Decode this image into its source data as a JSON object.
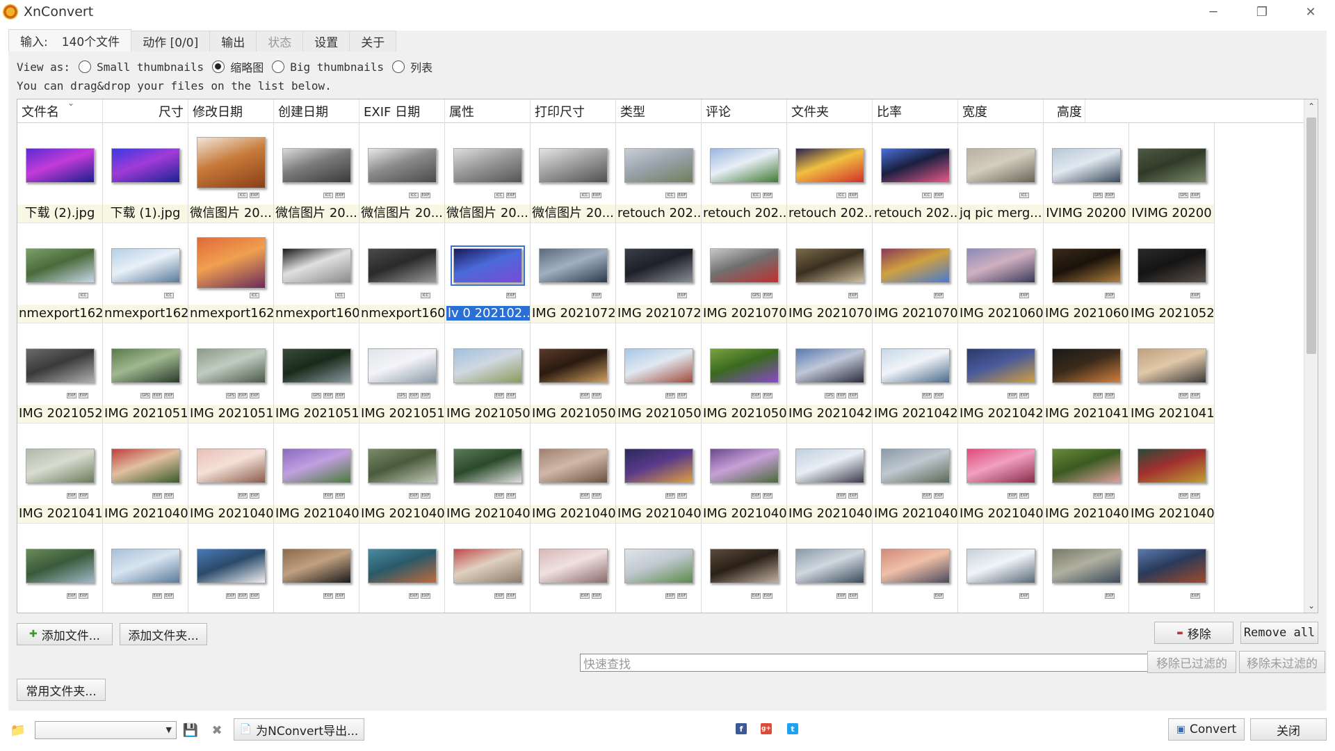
{
  "window": {
    "title": "XnConvert",
    "minimize": "─",
    "restore": "❐",
    "close": "✕"
  },
  "tabs": [
    {
      "label": "输入:",
      "count": "140个文件",
      "active": true,
      "disabled": false
    },
    {
      "label": "动作 [0/0]",
      "active": false,
      "disabled": false
    },
    {
      "label": "输出",
      "active": false,
      "disabled": false
    },
    {
      "label": "状态",
      "active": false,
      "disabled": true
    },
    {
      "label": "设置",
      "active": false,
      "disabled": false
    },
    {
      "label": "关于",
      "active": false,
      "disabled": false
    }
  ],
  "view_as": {
    "label": "View as:",
    "options": [
      {
        "label": "Small thumbnails",
        "checked": false
      },
      {
        "label": "缩略图",
        "checked": true
      },
      {
        "label": "Big thumbnails",
        "checked": false
      },
      {
        "label": "列表",
        "checked": false
      }
    ]
  },
  "hint": "You can drag&drop your files on the list below.",
  "columns": [
    "文件名",
    "尺寸",
    "修改日期",
    "创建日期",
    "EXIF 日期",
    "属性",
    "打印尺寸",
    "类型",
    "评论",
    "文件夹",
    "比率",
    "宽度",
    "高度"
  ],
  "files": [
    {
      "name": "下载 (2).jpg",
      "colors": [
        "#5a2bd1",
        "#1b1f8a",
        "#c33bd9"
      ],
      "badges": []
    },
    {
      "name": "下载 (1).jpg",
      "colors": [
        "#3a3ae0",
        "#1c2390",
        "#a13bd8"
      ],
      "badges": []
    },
    {
      "name": "微信图片 20...",
      "colors": [
        "#f0e6d8",
        "#8a3e16",
        "#c77a3a"
      ],
      "badges": [
        "ICC",
        "EXIF"
      ],
      "tall": true
    },
    {
      "name": "微信图片 20...",
      "colors": [
        "#d9d9d9",
        "#3a3a3a",
        "#7a7a7a"
      ],
      "badges": [
        "ICC",
        "EXIF"
      ]
    },
    {
      "name": "微信图片 20...",
      "colors": [
        "#e8e8e8",
        "#4a4a4a",
        "#8a8a8a"
      ],
      "badges": [
        "ICC",
        "EXIF"
      ]
    },
    {
      "name": "微信图片 20...",
      "colors": [
        "#dedede",
        "#555555",
        "#9a9a9a"
      ],
      "badges": [
        "ICC",
        "EXIF"
      ]
    },
    {
      "name": "微信图片 20...",
      "colors": [
        "#e4e4e4",
        "#505050",
        "#a0a0a0"
      ],
      "badges": [
        "ICC",
        "EXIF"
      ]
    },
    {
      "name": "retouch 202...",
      "colors": [
        "#c9ced6",
        "#6e7f5a",
        "#9aa3ad"
      ],
      "badges": [
        "ICC",
        "EXIF"
      ]
    },
    {
      "name": "retouch 202...",
      "colors": [
        "#9ab6e0",
        "#3f7a34",
        "#e8eef5"
      ],
      "badges": [
        "ICC",
        "EXIF"
      ]
    },
    {
      "name": "retouch 202...",
      "colors": [
        "#2a2450",
        "#d0302a",
        "#f0c040"
      ],
      "badges": [
        "ICC",
        "EXIF"
      ]
    },
    {
      "name": "retouch 202...",
      "colors": [
        "#4a6fd8",
        "#e85a8a",
        "#1a1f40"
      ],
      "badges": [
        "ICC",
        "EXIF"
      ]
    },
    {
      "name": "jq pic merg...",
      "colors": [
        "#b8b0a0",
        "#6a6458",
        "#d4cec0"
      ],
      "badges": [
        "ICC"
      ]
    },
    {
      "name": "IVIMG 20200",
      "colors": [
        "#b8c8d8",
        "#3a4a5a",
        "#e0e8f0"
      ],
      "badges": [
        "GPS",
        "EXIF"
      ]
    },
    {
      "name": "IVIMG 20200",
      "colors": [
        "#4f5a44",
        "#7a8a6a",
        "#2f3a28"
      ],
      "badges": [
        "GPS",
        "EXIF"
      ]
    },
    {
      "name": "nmexport162...",
      "colors": [
        "#7aa06a",
        "#c6d8e8",
        "#4a6a3a"
      ],
      "badges": [
        "ICC"
      ]
    },
    {
      "name": "nmexport162...",
      "colors": [
        "#b6cfe6",
        "#5a7a9a",
        "#e8f0f8"
      ],
      "badges": [
        "ICC"
      ]
    },
    {
      "name": "nmexport162...",
      "colors": [
        "#e06a3a",
        "#6a2a5a",
        "#f0a050"
      ],
      "badges": [
        "ICC"
      ],
      "tall": true
    },
    {
      "name": "nmexport160...",
      "colors": [
        "#1a1a1a",
        "#8a8a8a",
        "#e0e0e0"
      ],
      "badges": [
        "ICC"
      ]
    },
    {
      "name": "nmexport160...",
      "colors": [
        "#4a4a4a",
        "#9a9a9a",
        "#2a2a2a"
      ],
      "badges": [
        "ICC"
      ]
    },
    {
      "name": "lv 0 202102...",
      "colors": [
        "#1a1a5a",
        "#7a4ad8",
        "#4a6ad8"
      ],
      "badges": [
        "EXIF"
      ],
      "selected": true
    },
    {
      "name": "IMG 2021072...",
      "colors": [
        "#5a6a7a",
        "#2a3a4a",
        "#a0b0c0"
      ],
      "badges": [
        "EXIF"
      ]
    },
    {
      "name": "IMG 2021072...",
      "colors": [
        "#3a3e48",
        "#8a8e98",
        "#1e2028"
      ],
      "badges": [
        "EXIF"
      ]
    },
    {
      "name": "IMG 2021070...",
      "colors": [
        "#c8c8c8",
        "#c03030",
        "#707070"
      ],
      "badges": [
        "GPS",
        "EXIF"
      ]
    },
    {
      "name": "IMG 2021070...",
      "colors": [
        "#7a6a4a",
        "#d0c0a0",
        "#3a3020"
      ],
      "badges": [
        "EXIF"
      ]
    },
    {
      "name": "IMG 2021070...",
      "colors": [
        "#8a3a5a",
        "#4a7ad0",
        "#d0a040"
      ],
      "badges": [
        "EXIF"
      ]
    },
    {
      "name": "IMG 2021060...",
      "colors": [
        "#8a8ab8",
        "#3a3a5a",
        "#d0b0c0"
      ],
      "badges": [
        "EXIF"
      ]
    },
    {
      "name": "IMG 2021060...",
      "colors": [
        "#3a2a1a",
        "#b08040",
        "#1a120a"
      ],
      "badges": [
        "EXIF"
      ]
    },
    {
      "name": "IMG 2021052...",
      "colors": [
        "#2a2a2a",
        "#5a5048",
        "#141414"
      ],
      "badges": [
        "EXIF"
      ]
    },
    {
      "name": "IMG 2021052...",
      "colors": [
        "#6a6a6a",
        "#b0b0b0",
        "#3a3a3a"
      ],
      "badges": [
        "EXIF",
        "EXIF"
      ]
    },
    {
      "name": "IMG 2021051...",
      "colors": [
        "#5a7a4a",
        "#2a3a2a",
        "#a0b890"
      ],
      "badges": [
        "GPS",
        "EXIF",
        "EXIF"
      ]
    },
    {
      "name": "IMG 2021051...",
      "colors": [
        "#8a9a88",
        "#4a5a48",
        "#c0ccc0"
      ],
      "badges": [
        "GPS",
        "EXIF",
        "EXIF"
      ]
    },
    {
      "name": "IMG 2021051...",
      "colors": [
        "#3a4a3a",
        "#8a9aa0",
        "#1a2a1a"
      ],
      "badges": [
        "GPS",
        "EXIF",
        "EXIF"
      ]
    },
    {
      "name": "IMG 2021051...",
      "colors": [
        "#e0e4ea",
        "#8a9aa8",
        "#f4f4f8"
      ],
      "badges": [
        "GPS",
        "EXIF",
        "EXIF"
      ]
    },
    {
      "name": "IMG 2021050...",
      "colors": [
        "#a0c0e0",
        "#8a9a5a",
        "#d0d8e0"
      ],
      "badges": [
        "EXIF",
        "EXIF"
      ]
    },
    {
      "name": "IMG 2021050...",
      "colors": [
        "#5a3a2a",
        "#d0a060",
        "#2a1a10"
      ],
      "badges": [
        "EXIF",
        "EXIF"
      ]
    },
    {
      "name": "IMG 2021050...",
      "colors": [
        "#a8c8e8",
        "#a04a3a",
        "#e0e8f0"
      ],
      "badges": [
        "EXIF",
        "EXIF"
      ]
    },
    {
      "name": "IMG 2021050...",
      "colors": [
        "#7aa040",
        "#8a4ac8",
        "#3a6a20"
      ],
      "badges": [
        "EXIF",
        "EXIF"
      ]
    },
    {
      "name": "IMG 2021042...",
      "colors": [
        "#5a7ab0",
        "#2a2a3a",
        "#c0c8d8"
      ],
      "badges": [
        "GPS",
        "EXIF",
        "EXIF"
      ]
    },
    {
      "name": "IMG 2021042...",
      "colors": [
        "#c8d8e8",
        "#4a6a8a",
        "#f0f4f8"
      ],
      "badges": [
        "EXIF",
        "EXIF"
      ]
    },
    {
      "name": "IMG 2021042...",
      "colors": [
        "#2a3a6a",
        "#d0a040",
        "#4a5a9a"
      ],
      "badges": [
        "EXIF",
        "EXIF"
      ]
    },
    {
      "name": "IMG 2021041...",
      "colors": [
        "#1a1a1a",
        "#d08040",
        "#3a2a1a"
      ],
      "badges": [
        "EXIF",
        "EXIF"
      ]
    },
    {
      "name": "IMG 2021041...",
      "colors": [
        "#c0a080",
        "#3a3a3a",
        "#e0c8a8"
      ],
      "badges": [
        "EXIF",
        "EXIF"
      ]
    },
    {
      "name": "IMG 2021041...",
      "colors": [
        "#b0b8a8",
        "#6a7a5a",
        "#d8dcd0"
      ],
      "badges": [
        "EXIF",
        "EXIF"
      ]
    },
    {
      "name": "IMG 2021040...",
      "colors": [
        "#c04040",
        "#3a5a2a",
        "#e0c0a0"
      ],
      "badges": [
        "EXIF",
        "EXIF"
      ]
    },
    {
      "name": "IMG 2021040...",
      "colors": [
        "#e8c0b8",
        "#8a5a4a",
        "#f4e0d8"
      ],
      "badges": [
        "EXIF",
        "EXIF"
      ]
    },
    {
      "name": "IMG 2021040...",
      "colors": [
        "#8a6ac0",
        "#4a7a3a",
        "#c0a0e0"
      ],
      "badges": [
        "EXIF",
        "EXIF"
      ]
    },
    {
      "name": "IMG 2021040...",
      "colors": [
        "#7a8a6a",
        "#c0c8b8",
        "#4a5a3a"
      ],
      "badges": [
        "EXIF",
        "EXIF"
      ]
    },
    {
      "name": "IMG 2021040...",
      "colors": [
        "#5a7a5a",
        "#e0e0e0",
        "#2a4a2a"
      ],
      "badges": [
        "EXIF",
        "EXIF"
      ]
    },
    {
      "name": "IMG 2021040...",
      "colors": [
        "#a08070",
        "#6a5040",
        "#d0b8a8"
      ],
      "badges": [
        "EXIF",
        "EXIF"
      ]
    },
    {
      "name": "IMG 2021040...",
      "colors": [
        "#2a2a5a",
        "#e0a040",
        "#5a3a8a"
      ],
      "badges": [
        "EXIF",
        "EXIF"
      ]
    },
    {
      "name": "IMG 2021040...",
      "colors": [
        "#6a4a8a",
        "#4a6a3a",
        "#c8a0d8"
      ],
      "badges": [
        "EXIF",
        "EXIF"
      ]
    },
    {
      "name": "IMG 2021040...",
      "colors": [
        "#c0d0e0",
        "#3a3a4a",
        "#e8eef4"
      ],
      "badges": [
        "EXIF",
        "EXIF"
      ]
    },
    {
      "name": "IMG 2021040...",
      "colors": [
        "#8a9aa8",
        "#5a6a58",
        "#c0c8d0"
      ],
      "badges": [
        "EXIF",
        "EXIF"
      ]
    },
    {
      "name": "IMG 2021040...",
      "colors": [
        "#e04a7a",
        "#8a2a4a",
        "#f0a0c0"
      ],
      "badges": [
        "EXIF",
        "EXIF"
      ]
    },
    {
      "name": "IMG 2021040...",
      "colors": [
        "#6a8a3a",
        "#e0a0a0",
        "#3a5a20"
      ],
      "badges": [
        "EXIF",
        "EXIF"
      ]
    },
    {
      "name": "IMG 2021040...",
      "colors": [
        "#2a4a3a",
        "#c0a030",
        "#a03030"
      ],
      "badges": [
        "EXIF",
        "EXIF"
      ]
    },
    {
      "name": "",
      "colors": [
        "#6a8a5a",
        "#a0b8c8",
        "#3a5a3a"
      ],
      "badges": [
        "EXIF",
        "EXIF"
      ]
    },
    {
      "name": "",
      "colors": [
        "#a8c0d8",
        "#5a7a9a",
        "#d8e4f0"
      ],
      "badges": [
        "EXIF",
        "EXIF"
      ]
    },
    {
      "name": "",
      "colors": [
        "#4a7ab8",
        "#f0f0f0",
        "#2a4a6a"
      ],
      "badges": [
        "EXIF",
        "EXIF",
        "EXIF"
      ]
    },
    {
      "name": "",
      "colors": [
        "#8a6a4a",
        "#1a1a1a",
        "#c0a080"
      ],
      "badges": [
        "EXIF",
        "EXIF"
      ]
    },
    {
      "name": "",
      "colors": [
        "#4a8aa0",
        "#c06a3a",
        "#2a5a6a"
      ],
      "badges": [
        "EXIF",
        "EXIF"
      ]
    },
    {
      "name": "",
      "colors": [
        "#c04a4a",
        "#8a7a6a",
        "#e0d0c0"
      ],
      "badges": [
        "EXIF",
        "EXIF"
      ]
    },
    {
      "name": "",
      "colors": [
        "#d8b8b8",
        "#8a6a6a",
        "#f0e0e0"
      ],
      "badges": [
        "EXIF",
        "EXIF"
      ]
    },
    {
      "name": "",
      "colors": [
        "#e0e4ea",
        "#5a8a4a",
        "#c0c8d0"
      ],
      "badges": [
        "EXIF",
        "EXIF"
      ]
    },
    {
      "name": "",
      "colors": [
        "#5a4a3a",
        "#c0b0a0",
        "#2a2018"
      ],
      "badges": [
        "EXIF",
        "EXIF"
      ]
    },
    {
      "name": "",
      "colors": [
        "#8a9aa8",
        "#3a4a5a",
        "#d0d8e0"
      ],
      "badges": [
        "EXIF",
        "EXIF"
      ]
    },
    {
      "name": "",
      "colors": [
        "#d08a7a",
        "#4a4a5a",
        "#f0c0a8"
      ],
      "badges": [
        "EXIF"
      ]
    },
    {
      "name": "",
      "colors": [
        "#c8d0d8",
        "#5a6a7a",
        "#f0f4f8"
      ],
      "badges": [
        "EXIF"
      ]
    },
    {
      "name": "",
      "colors": [
        "#7a7a6a",
        "#3a4a5a",
        "#b0b0a0"
      ],
      "badges": [
        "EXIF"
      ]
    },
    {
      "name": "",
      "colors": [
        "#5a7ab0",
        "#a04a2a",
        "#2a3a5a"
      ],
      "badges": [
        "EXIF"
      ]
    }
  ],
  "buttons": {
    "add_files": "添加文件...",
    "add_folder": "添加文件夹...",
    "remove": "移除",
    "remove_all": "Remove all",
    "remove_filtered": "移除已过滤的",
    "remove_unfiltered": "移除未过滤的",
    "common_folders": "常用文件夹...",
    "export_nconvert": "为NConvert导出...",
    "convert": "Convert",
    "close": "关闭"
  },
  "search": {
    "placeholder": "快速查找",
    "value": ""
  },
  "icons": {
    "add": "✚",
    "remove": "▬",
    "folder": "📁",
    "save": "💾",
    "delete": "✖",
    "export": "📄",
    "convert": "▣",
    "facebook": "f",
    "googleplus": "g+",
    "twitter": "t"
  },
  "colors": {
    "caption_bg": "#f7f7e4",
    "selection": "#2a6fd6",
    "facebook": "#3b5998",
    "googleplus": "#dd4b39",
    "twitter": "#1da1f2"
  }
}
